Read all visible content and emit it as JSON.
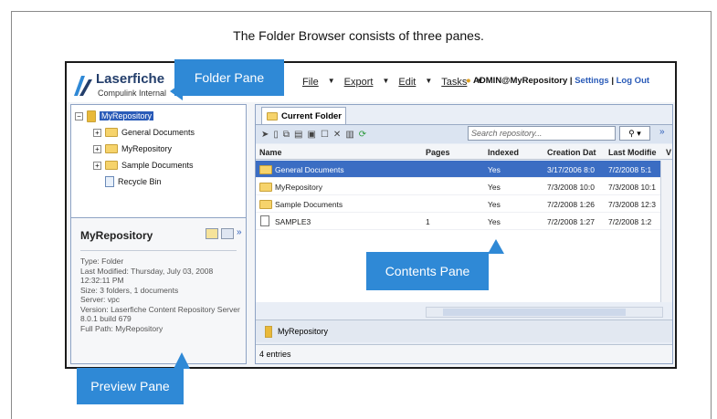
{
  "caption": "The Folder Browser consists of three panes.",
  "app": {
    "brand": "Laserfiche",
    "brand_sub": "Compulink Internal",
    "menu": [
      "File",
      "Export",
      "Edit",
      "Tasks"
    ],
    "user": "ADMIN@MyRepository",
    "settings": "Settings",
    "logout": "Log Out"
  },
  "tree": {
    "root": "MyRepository",
    "children": [
      "General Documents",
      "MyRepository",
      "Sample Documents",
      "Recycle Bin"
    ]
  },
  "preview": {
    "title": "MyRepository",
    "lines": [
      "Type: Folder",
      "Last Modified: Thursday, July 03, 2008 12:32:11 PM",
      "Size: 3 folders, 1 documents",
      "Server: vpc",
      "Version: Laserfiche Content Repository Server 8.0.1 build 679",
      "Full Path: MyRepository"
    ]
  },
  "contents": {
    "tab": "Current Folder",
    "search_placeholder": "Search repository...",
    "columns": [
      "Name",
      "Pages",
      "Indexed",
      "Creation Dat",
      "Last Modifie",
      "V"
    ],
    "rows": [
      {
        "name": "General Documents",
        "pages": "",
        "indexed": "Yes",
        "created": "3/17/2006 8:0",
        "modified": "7/2/2008 5:1"
      },
      {
        "name": "MyRepository",
        "pages": "",
        "indexed": "Yes",
        "created": "7/3/2008 10:0",
        "modified": "7/3/2008 10:1"
      },
      {
        "name": "Sample Documents",
        "pages": "",
        "indexed": "Yes",
        "created": "7/2/2008 1:26",
        "modified": "7/3/2008 12:3"
      },
      {
        "name": "SAMPLE3",
        "pages": "1",
        "indexed": "Yes",
        "created": "7/2/2008 1:27",
        "modified": "7/2/2008 1:2"
      }
    ],
    "path": "MyRepository",
    "status": "4 entries"
  },
  "callouts": {
    "folder": "Folder Pane",
    "contents": "Contents Pane",
    "preview": "Preview Pane"
  },
  "colors": {
    "callout": "#2f89d6",
    "selection": "#3b6dc3",
    "link": "#2a5bb8"
  }
}
